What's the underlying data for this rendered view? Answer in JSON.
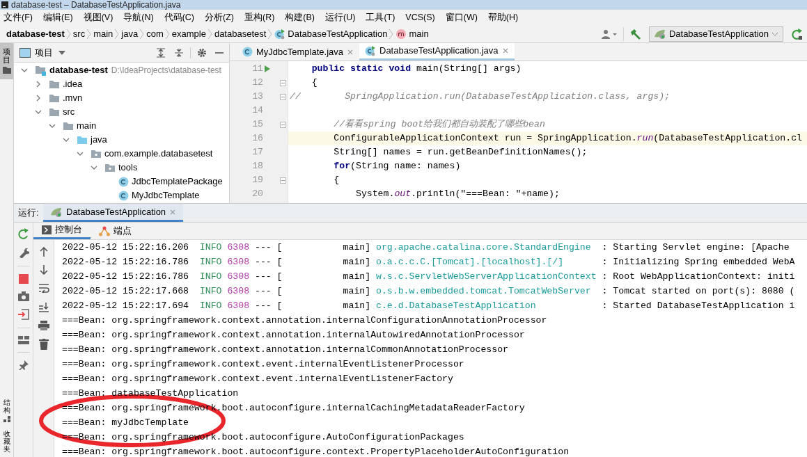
{
  "window": {
    "title": "database-test – DatabaseTestApplication.java"
  },
  "menu": [
    "文件(F)",
    "编辑(E)",
    "视图(V)",
    "导航(N)",
    "代码(C)",
    "分析(Z)",
    "重构(R)",
    "构建(B)",
    "运行(U)",
    "工具(T)",
    "VCS(S)",
    "窗口(W)",
    "帮助(H)"
  ],
  "navigation_bar": {
    "breadcrumbs": [
      {
        "label": "database-test",
        "kind": "project"
      },
      {
        "label": "src",
        "kind": "dir"
      },
      {
        "label": "main",
        "kind": "dir"
      },
      {
        "label": "java",
        "kind": "dir"
      },
      {
        "label": "com",
        "kind": "dir"
      },
      {
        "label": "example",
        "kind": "dir"
      },
      {
        "label": "databasetest",
        "kind": "dir"
      },
      {
        "label": "DatabaseTestApplication",
        "kind": "class"
      },
      {
        "label": "main",
        "kind": "method"
      }
    ],
    "run_configuration": "DatabaseTestApplication"
  },
  "side_tabs": [
    {
      "label": "项目",
      "selected": true
    }
  ],
  "side_tabs_bottom": [
    {
      "label": "结构",
      "selected": false
    },
    {
      "label": "收藏夹",
      "selected": false
    }
  ],
  "project_panel": {
    "title": "项目",
    "tree": [
      {
        "label": "database-test",
        "path": "D:\\IdeaProjects\\database-test",
        "kind": "module",
        "expanded": true,
        "children": [
          {
            "label": ".idea",
            "kind": "folder",
            "expanded": false
          },
          {
            "label": ".mvn",
            "kind": "folder",
            "expanded": false
          },
          {
            "label": "src",
            "kind": "folder",
            "expanded": true,
            "children": [
              {
                "label": "main",
                "kind": "folder",
                "expanded": true,
                "children": [
                  {
                    "label": "java",
                    "kind": "source",
                    "expanded": true,
                    "children": [
                      {
                        "label": "com.example.databasetest",
                        "kind": "package",
                        "expanded": true,
                        "children": [
                          {
                            "label": "tools",
                            "kind": "package",
                            "expanded": true,
                            "children": [
                              {
                                "label": "JdbcTemplatePackage",
                                "kind": "class"
                              },
                              {
                                "label": "MyJdbcTemplate",
                                "kind": "class"
                              }
                            ]
                          }
                        ]
                      }
                    ]
                  }
                ]
              }
            ]
          }
        ]
      }
    ]
  },
  "editor": {
    "tabs": [
      {
        "label": "MyJdbcTemplate.java",
        "kind": "class",
        "selected": false
      },
      {
        "label": "DatabaseTestApplication.java",
        "kind": "app",
        "selected": true
      }
    ],
    "lines": [
      {
        "number": "11",
        "kind": "code",
        "text": "    **public static void** main(String[] args)",
        "run_marker": true,
        "fold": false,
        "current": false
      },
      {
        "number": "12",
        "kind": "code",
        "text": "    {",
        "run_marker": false,
        "fold": true,
        "current": false
      },
      {
        "number": "13",
        "kind": "comment",
        "text": "//        SpringApplication.run(DatabaseTestApplication.class, args);",
        "run_marker": false,
        "fold": true,
        "current": false
      },
      {
        "number": "14",
        "kind": "code",
        "run_marker": false,
        "fold": false,
        "current": false
      },
      {
        "number": "15",
        "kind": "comment",
        "text": "        //看看spring boot给我们都自动装配了哪些bean",
        "run_marker": false,
        "fold": true,
        "current": false
      },
      {
        "number": "16",
        "kind": "code",
        "text": "        ConfigurableApplicationContext run = SpringApplication.*run*(DatabaseTestApplication.cl",
        "run_marker": false,
        "fold": false,
        "current": true
      },
      {
        "number": "17",
        "kind": "code",
        "text": "        String[] names = run.getBeanDefinitionNames();",
        "run_marker": false,
        "fold": false,
        "current": false
      },
      {
        "number": "18",
        "kind": "code",
        "text": "        **for**(String name: names)",
        "run_marker": false,
        "fold": false,
        "current": false
      },
      {
        "number": "19",
        "kind": "code",
        "text": "        {",
        "run_marker": false,
        "fold": true,
        "current": false
      },
      {
        "number": "20",
        "kind": "code",
        "text": "            System.*out*.println(\"===Bean: \"+name);",
        "run_marker": false,
        "fold": false,
        "current": false
      }
    ]
  },
  "run_panel": {
    "label": "运行:",
    "tabs": [
      {
        "label": "DatabaseTestApplication",
        "selected": true
      }
    ],
    "subtabs": [
      {
        "label": "控制台",
        "kind": "console",
        "selected": true
      },
      {
        "label": "端点",
        "kind": "endpoints",
        "selected": false
      }
    ],
    "output": [
      {
        "kind": "log",
        "time": "2022-05-12 15:22:16.206",
        "level": "INFO",
        "pid": "6308",
        "separator": "---",
        "thread": "[           main]",
        "logger": "org.apache.catalina.core.StandardEngine",
        "message": ": Starting Servlet engine: [Apache"
      },
      {
        "kind": "log",
        "time": "2022-05-12 15:22:16.786",
        "level": "INFO",
        "pid": "6308",
        "separator": "---",
        "thread": "[           main]",
        "logger": "o.a.c.c.C.[Tomcat].[localhost].[/]",
        "message": ": Initializing Spring embedded WebA"
      },
      {
        "kind": "log",
        "time": "2022-05-12 15:22:16.786",
        "level": "INFO",
        "pid": "6308",
        "separator": "---",
        "thread": "[           main]",
        "logger": "w.s.c.ServletWebServerApplicationContext",
        "message": ": Root WebApplicationContext: initi"
      },
      {
        "kind": "log",
        "time": "2022-05-12 15:22:17.668",
        "level": "INFO",
        "pid": "6308",
        "separator": "---",
        "thread": "[           main]",
        "logger": "o.s.b.w.embedded.tomcat.TomcatWebServer",
        "message": ": Tomcat started on port(s): 8080 ("
      },
      {
        "kind": "log",
        "time": "2022-05-12 15:22:17.694",
        "level": "INFO",
        "pid": "6308",
        "separator": "---",
        "thread": "[           main]",
        "logger": "c.e.d.DatabaseTestApplication",
        "message": ": Started DatabaseTestApplication i"
      },
      {
        "kind": "text",
        "text": "===Bean: org.springframework.context.annotation.internalConfigurationAnnotationProcessor"
      },
      {
        "kind": "text",
        "text": "===Bean: org.springframework.context.annotation.internalAutowiredAnnotationProcessor"
      },
      {
        "kind": "text",
        "text": "===Bean: org.springframework.context.annotation.internalCommonAnnotationProcessor"
      },
      {
        "kind": "text",
        "text": "===Bean: org.springframework.context.event.internalEventListenerProcessor"
      },
      {
        "kind": "text",
        "text": "===Bean: org.springframework.context.event.internalEventListenerFactory"
      },
      {
        "kind": "text",
        "text": "===Bean: databaseTestApplication"
      },
      {
        "kind": "text",
        "text": "===Bean: org.springframework.boot.autoconfigure.internalCachingMetadataReaderFactory"
      },
      {
        "kind": "text",
        "text": "===Bean: myJdbcTemplate"
      },
      {
        "kind": "text",
        "text": "===Bean: org.springframework.boot.autoconfigure.AutoConfigurationPackages"
      },
      {
        "kind": "text",
        "text": "===Bean: org.springframework.boot.autoconfigure.context.PropertyPlaceholderAutoConfiguration"
      }
    ]
  }
}
